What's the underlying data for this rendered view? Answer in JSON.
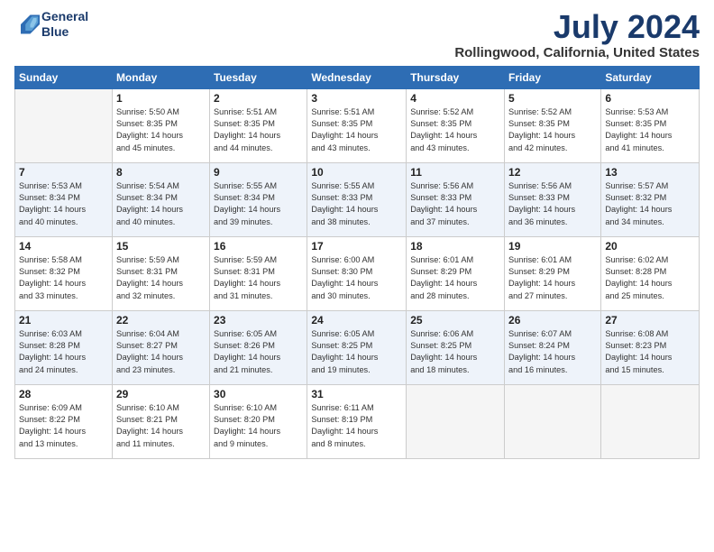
{
  "header": {
    "logo_line1": "General",
    "logo_line2": "Blue",
    "title": "July 2024",
    "subtitle": "Rollingwood, California, United States"
  },
  "days_of_week": [
    "Sunday",
    "Monday",
    "Tuesday",
    "Wednesday",
    "Thursday",
    "Friday",
    "Saturday"
  ],
  "weeks": [
    [
      {
        "num": "",
        "info": ""
      },
      {
        "num": "1",
        "info": "Sunrise: 5:50 AM\nSunset: 8:35 PM\nDaylight: 14 hours\nand 45 minutes."
      },
      {
        "num": "2",
        "info": "Sunrise: 5:51 AM\nSunset: 8:35 PM\nDaylight: 14 hours\nand 44 minutes."
      },
      {
        "num": "3",
        "info": "Sunrise: 5:51 AM\nSunset: 8:35 PM\nDaylight: 14 hours\nand 43 minutes."
      },
      {
        "num": "4",
        "info": "Sunrise: 5:52 AM\nSunset: 8:35 PM\nDaylight: 14 hours\nand 43 minutes."
      },
      {
        "num": "5",
        "info": "Sunrise: 5:52 AM\nSunset: 8:35 PM\nDaylight: 14 hours\nand 42 minutes."
      },
      {
        "num": "6",
        "info": "Sunrise: 5:53 AM\nSunset: 8:35 PM\nDaylight: 14 hours\nand 41 minutes."
      }
    ],
    [
      {
        "num": "7",
        "info": "Sunrise: 5:53 AM\nSunset: 8:34 PM\nDaylight: 14 hours\nand 40 minutes."
      },
      {
        "num": "8",
        "info": "Sunrise: 5:54 AM\nSunset: 8:34 PM\nDaylight: 14 hours\nand 40 minutes."
      },
      {
        "num": "9",
        "info": "Sunrise: 5:55 AM\nSunset: 8:34 PM\nDaylight: 14 hours\nand 39 minutes."
      },
      {
        "num": "10",
        "info": "Sunrise: 5:55 AM\nSunset: 8:33 PM\nDaylight: 14 hours\nand 38 minutes."
      },
      {
        "num": "11",
        "info": "Sunrise: 5:56 AM\nSunset: 8:33 PM\nDaylight: 14 hours\nand 37 minutes."
      },
      {
        "num": "12",
        "info": "Sunrise: 5:56 AM\nSunset: 8:33 PM\nDaylight: 14 hours\nand 36 minutes."
      },
      {
        "num": "13",
        "info": "Sunrise: 5:57 AM\nSunset: 8:32 PM\nDaylight: 14 hours\nand 34 minutes."
      }
    ],
    [
      {
        "num": "14",
        "info": "Sunrise: 5:58 AM\nSunset: 8:32 PM\nDaylight: 14 hours\nand 33 minutes."
      },
      {
        "num": "15",
        "info": "Sunrise: 5:59 AM\nSunset: 8:31 PM\nDaylight: 14 hours\nand 32 minutes."
      },
      {
        "num": "16",
        "info": "Sunrise: 5:59 AM\nSunset: 8:31 PM\nDaylight: 14 hours\nand 31 minutes."
      },
      {
        "num": "17",
        "info": "Sunrise: 6:00 AM\nSunset: 8:30 PM\nDaylight: 14 hours\nand 30 minutes."
      },
      {
        "num": "18",
        "info": "Sunrise: 6:01 AM\nSunset: 8:29 PM\nDaylight: 14 hours\nand 28 minutes."
      },
      {
        "num": "19",
        "info": "Sunrise: 6:01 AM\nSunset: 8:29 PM\nDaylight: 14 hours\nand 27 minutes."
      },
      {
        "num": "20",
        "info": "Sunrise: 6:02 AM\nSunset: 8:28 PM\nDaylight: 14 hours\nand 25 minutes."
      }
    ],
    [
      {
        "num": "21",
        "info": "Sunrise: 6:03 AM\nSunset: 8:28 PM\nDaylight: 14 hours\nand 24 minutes."
      },
      {
        "num": "22",
        "info": "Sunrise: 6:04 AM\nSunset: 8:27 PM\nDaylight: 14 hours\nand 23 minutes."
      },
      {
        "num": "23",
        "info": "Sunrise: 6:05 AM\nSunset: 8:26 PM\nDaylight: 14 hours\nand 21 minutes."
      },
      {
        "num": "24",
        "info": "Sunrise: 6:05 AM\nSunset: 8:25 PM\nDaylight: 14 hours\nand 19 minutes."
      },
      {
        "num": "25",
        "info": "Sunrise: 6:06 AM\nSunset: 8:25 PM\nDaylight: 14 hours\nand 18 minutes."
      },
      {
        "num": "26",
        "info": "Sunrise: 6:07 AM\nSunset: 8:24 PM\nDaylight: 14 hours\nand 16 minutes."
      },
      {
        "num": "27",
        "info": "Sunrise: 6:08 AM\nSunset: 8:23 PM\nDaylight: 14 hours\nand 15 minutes."
      }
    ],
    [
      {
        "num": "28",
        "info": "Sunrise: 6:09 AM\nSunset: 8:22 PM\nDaylight: 14 hours\nand 13 minutes."
      },
      {
        "num": "29",
        "info": "Sunrise: 6:10 AM\nSunset: 8:21 PM\nDaylight: 14 hours\nand 11 minutes."
      },
      {
        "num": "30",
        "info": "Sunrise: 6:10 AM\nSunset: 8:20 PM\nDaylight: 14 hours\nand 9 minutes."
      },
      {
        "num": "31",
        "info": "Sunrise: 6:11 AM\nSunset: 8:19 PM\nDaylight: 14 hours\nand 8 minutes."
      },
      {
        "num": "",
        "info": ""
      },
      {
        "num": "",
        "info": ""
      },
      {
        "num": "",
        "info": ""
      }
    ]
  ]
}
